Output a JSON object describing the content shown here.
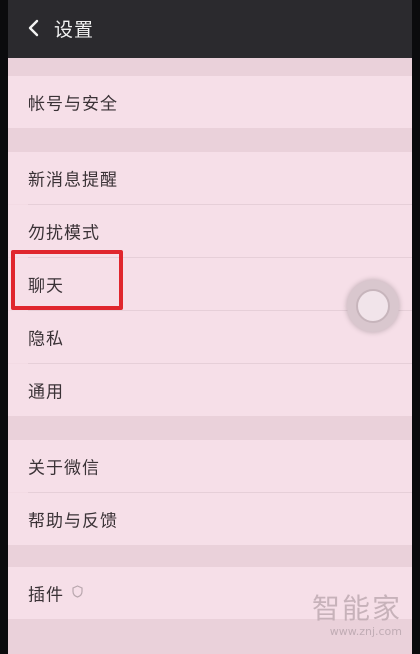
{
  "header": {
    "title": "设置"
  },
  "menu": {
    "account_security": "帐号与安全",
    "new_message_notify": "新消息提醒",
    "do_not_disturb": "勿扰模式",
    "chat": "聊天",
    "privacy": "隐私",
    "general": "通用",
    "about_wechat": "关于微信",
    "help_feedback": "帮助与反馈",
    "plugins": "插件"
  },
  "icons": {
    "back": "back-chevron-icon",
    "floating_assistive": "assistive-touch-icon",
    "plugin_badge": "shield-icon"
  },
  "watermark": {
    "brand": "智能家",
    "url": "www.znj.com"
  },
  "colors": {
    "header_bg": "#2b2a2e",
    "page_bg": "#f3dbe4",
    "highlight_border": "#e0262d"
  }
}
